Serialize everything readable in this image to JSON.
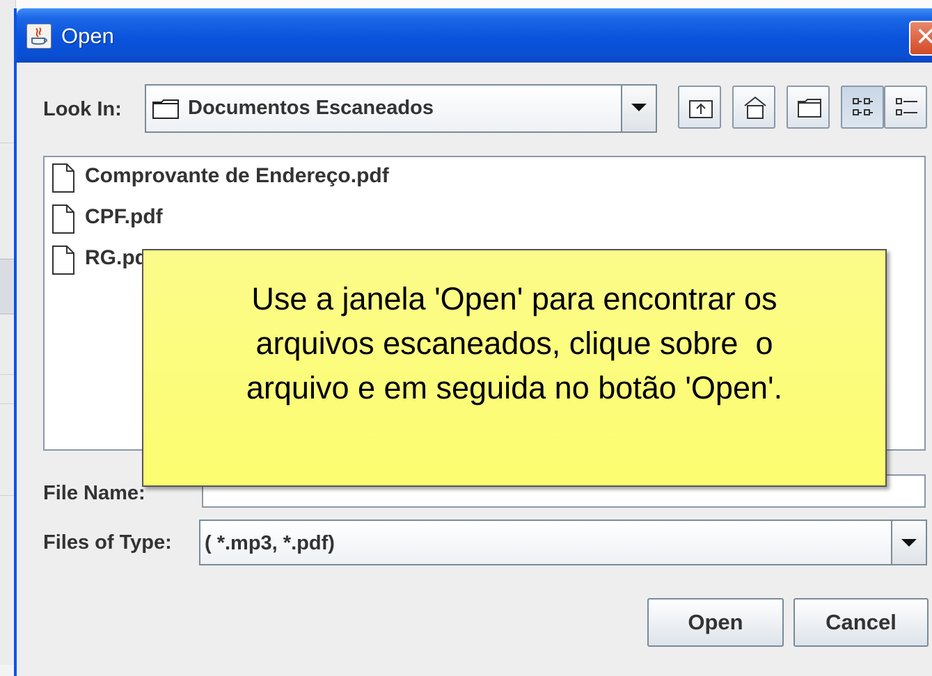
{
  "window": {
    "title": "Open",
    "close_glyph": "✕"
  },
  "look_in": {
    "label": "Look In:",
    "value": "Documentos Escaneados",
    "toolbar": [
      "up-folder-icon",
      "home-folder-icon",
      "new-folder-icon",
      "list-view-icon",
      "details-view-icon"
    ]
  },
  "files": [
    {
      "name": "Comprovante de Endereço.pdf"
    },
    {
      "name": "CPF.pdf"
    },
    {
      "name": "RG.pdf"
    }
  ],
  "file_name": {
    "label": "File Name:",
    "value": ""
  },
  "files_of_type": {
    "label": "Files of Type:",
    "value": "( *.mp3, *.pdf)"
  },
  "buttons": {
    "open": "Open",
    "cancel": "Cancel"
  },
  "tooltip": {
    "line1": "Use a janela 'Open' para encontrar os",
    "line2": "arquivos escaneados, clique sobre  o",
    "line3": "arquivo e em seguida no botão 'Open'."
  },
  "colors": {
    "titlebar": "#0a53dc",
    "tooltip_bg": "#fdfd70",
    "close_btn": "#d24a26"
  }
}
